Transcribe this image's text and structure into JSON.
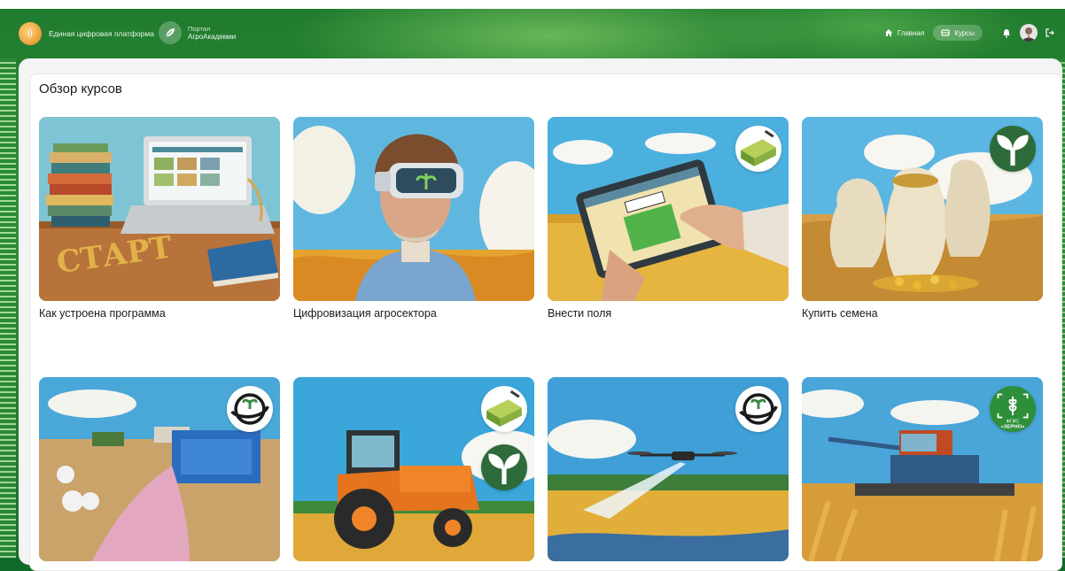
{
  "header": {
    "platform_name": "Единая цифровая платформа",
    "portal_caption": "Портал",
    "portal_name": "АгроАкадемии",
    "nav_home": "Главная",
    "nav_courses": "Курсы"
  },
  "main": {
    "title": "Обзор курсов"
  },
  "courses": [
    {
      "title": "Как устроена программа",
      "image": "books-laptop-start"
    },
    {
      "title": "Цифровизация агросектора",
      "image": "farmer-vr-headset"
    },
    {
      "title": "Внести поля",
      "image": "tablet-field-map",
      "badges": [
        "field-map-icon"
      ]
    },
    {
      "title": "Купить семена",
      "image": "seed-sacks-coins",
      "badges": [
        "sprout-icon"
      ]
    },
    {
      "title": "",
      "image": "fertilizer-spreader",
      "badges": [
        "planet-sprout-icon"
      ]
    },
    {
      "title": "",
      "image": "orange-tractor",
      "badges": [
        "field-map-icon",
        "sprout-icon"
      ]
    },
    {
      "title": "",
      "image": "spraying-drone",
      "badges": [
        "planet-sprout-icon"
      ]
    },
    {
      "title": "",
      "image": "combine-harvester",
      "badges": [
        "fgis-zerno-icon"
      ]
    }
  ],
  "badge_text": {
    "fgis_line1": "ФГИС",
    "fgis_line2": "«ЗЕРНО»"
  },
  "colors": {
    "accent_green": "#2d6b3a",
    "header_green": "#2f8f37"
  }
}
